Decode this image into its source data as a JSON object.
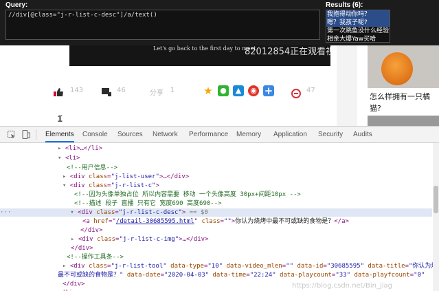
{
  "xpath_helper": {
    "query_label": "Query:",
    "query_value": "//div[@class=\"j-r-list-c-desc\"]/a/text()",
    "results_label": "Results (6):",
    "results": [
      "我抱得动你吗？",
      "嗯？我孩子呢?",
      "第一次跳鱼没什么经验?",
      "相亲大爆Yaw买哈"
    ]
  },
  "video": {
    "caption": "Let's go back to the first day to meet",
    "watermark": "82012854正在观看视频"
  },
  "post_actions": {
    "likes": "143",
    "dislikes": "46",
    "share_label": "分享",
    "share_count": "1",
    "comments": "47",
    "colors": {
      "qzone": "#f0a800",
      "wechat": "#2fb52f",
      "qq": "#1a8ad8",
      "weibo": "#e2322a",
      "more": "#3b88e3"
    }
  },
  "sidebar": {
    "card_title": "怎么样拥有一只橘猫?"
  },
  "devtools": {
    "tabs": [
      "Elements",
      "Console",
      "Sources",
      "Network",
      "Performance",
      "Memory",
      "Application",
      "Security",
      "Audits"
    ],
    "dom": {
      "l1": "<li>…</li>",
      "l2": "<li>",
      "l3": "<!--用户信息-->",
      "l4_class": "\"j-list-user\"",
      "l5_class": "\"j-r-list-c\"",
      "c1": "<!--因为头像单独占位 所以内容需要 移动 一个头像高度 30px+间距10px -->",
      "c2": "<!--描述 段子 直播 只有它 宽度690 高度690-->",
      "desc_class": "\"j-r-list-c-desc\"",
      "desc_suffix": " == $0",
      "href": "/detail-30685595.html",
      "a_class": "\"\"",
      "a_text": "你认为烧烤中最不可或缺的食物是？",
      "img_class": "\"j-r-list-c-img\"",
      "tool_comment": "<!--操作工具条-->",
      "tool_class": "\"j-r-list-tool\"",
      "data_type": "\"10\"",
      "data_video_mlen": "\"\"",
      "data_id": "\"30685595\"",
      "data_title_1": "\"你认为烧烤中",
      "data_title_2": "最不可或缺的食物是？\"",
      "data_date": "\"2020-04-03\"",
      "data_time": "\"22:24\"",
      "data_playcount": "\"33\"",
      "data_playfcount": "\"0\""
    }
  },
  "csdn_watermark": "https://blog.csdn.net/Bin_jiag"
}
